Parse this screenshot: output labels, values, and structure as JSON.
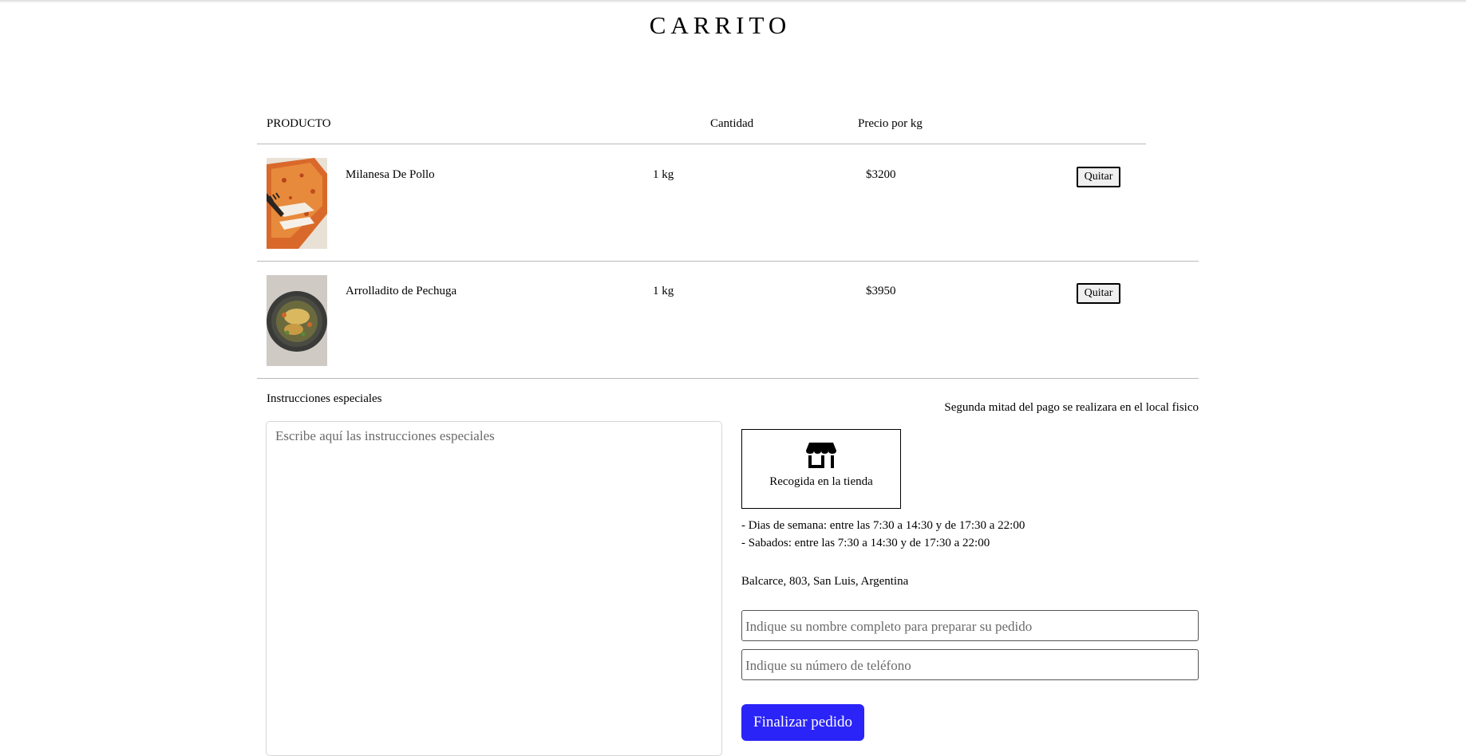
{
  "page": {
    "title": "CARRITO"
  },
  "table": {
    "headers": {
      "product": "PRODUCTO",
      "quantity": "Cantidad",
      "price": "Precio por kg"
    },
    "rows": [
      {
        "name": "Milanesa De Pollo",
        "quantity": "1 kg",
        "price": "$3200",
        "remove_label": "Quitar",
        "image": "milanesa-de-pollo-photo"
      },
      {
        "name": "Arrolladito de Pechuga",
        "quantity": "1 kg",
        "price": "$3950",
        "remove_label": "Quitar",
        "image": "arrolladito-de-pechuga-photo"
      }
    ]
  },
  "instructions": {
    "label": "Instrucciones especiales",
    "placeholder": "Escribe aquí las instrucciones especiales",
    "value": ""
  },
  "checkout": {
    "payment_note": "Segunda mitad del pago se realizara en el local fisico",
    "pickup": {
      "label": "Recogida en la tienda",
      "icon": "store-icon"
    },
    "hours": [
      "- Dias de semana: entre las 7:30 a 14:30 y de 17:30 a 22:00",
      "- Sabados: entre las 7:30 a 14:30 y de 17:30 a 22:00"
    ],
    "address": "Balcarce, 803, San Luis, Argentina",
    "name_field": {
      "placeholder": "Indique su nombre completo para preparar su pedido",
      "value": ""
    },
    "phone_field": {
      "placeholder": "Indique su número de teléfono",
      "value": ""
    },
    "submit_label": "Finalizar pedido"
  },
  "colors": {
    "accent": "#2b24f8",
    "divider": "#b9b9b9",
    "text": "#000000"
  }
}
